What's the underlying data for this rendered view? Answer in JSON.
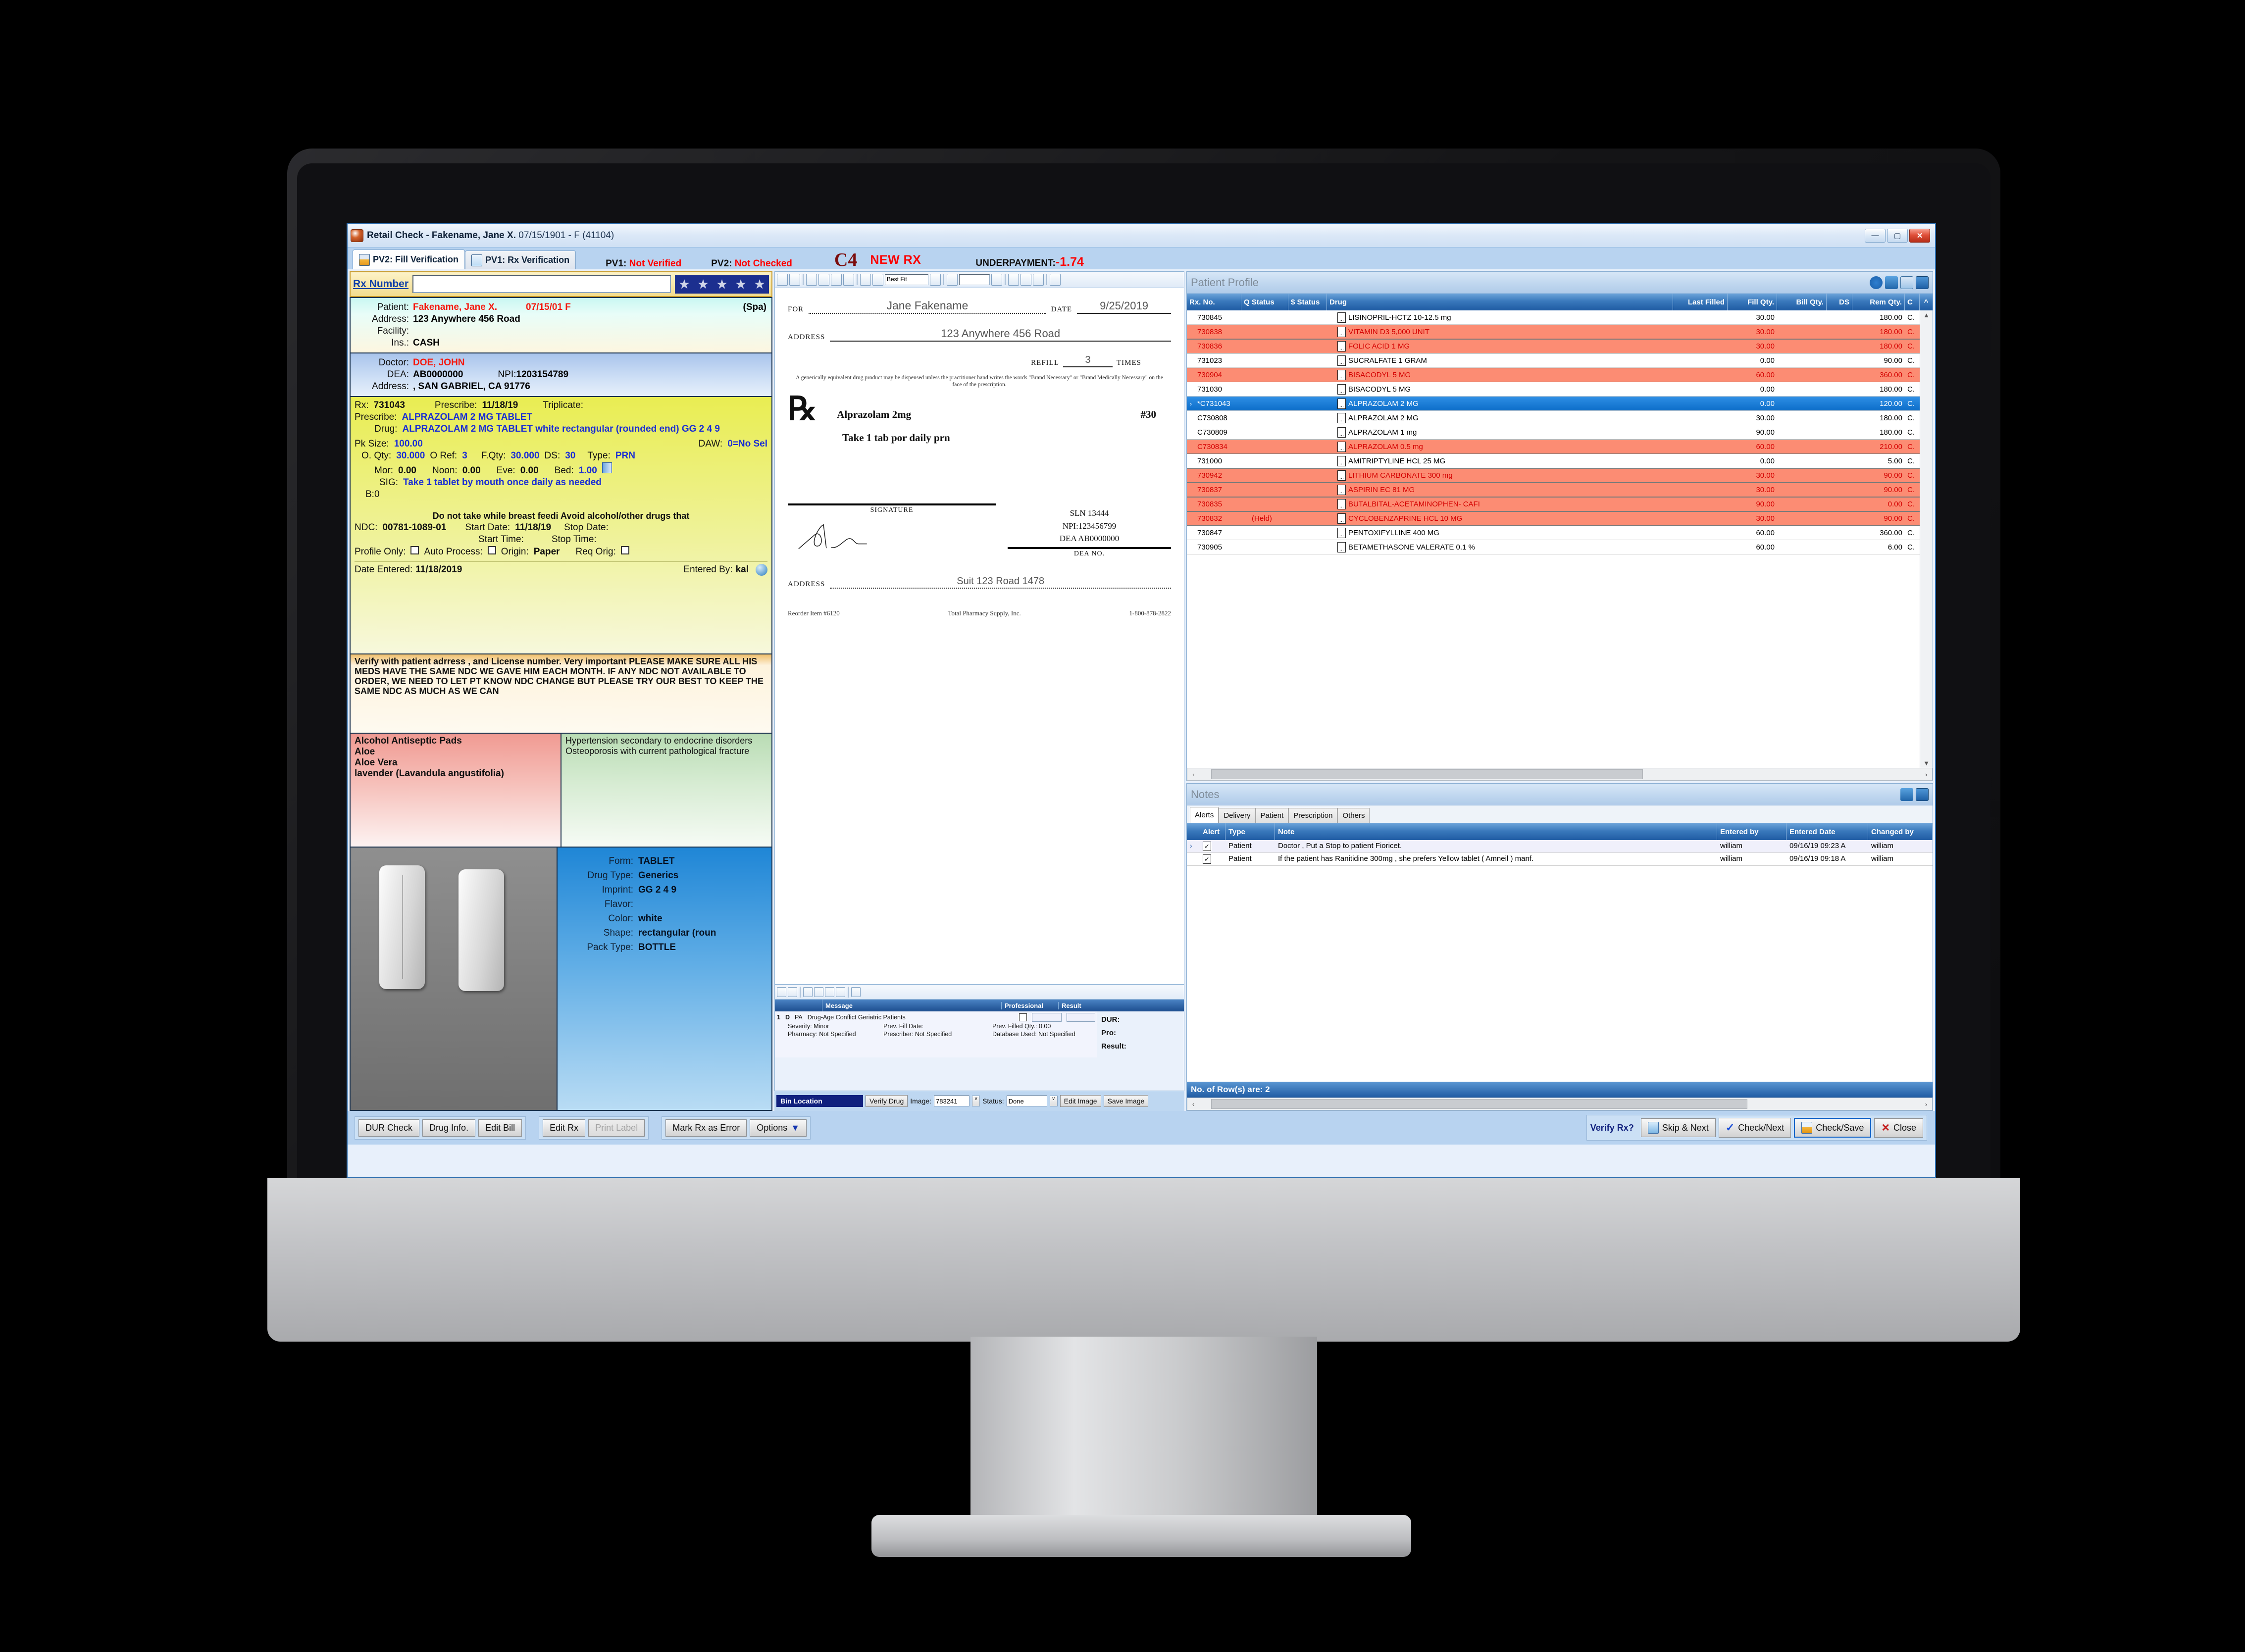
{
  "window": {
    "title_main": "Retail Check - Fakename, Jane X.",
    "title_sub": "07/15/1901 - F (41104)",
    "minimize": "—",
    "maximize": "▢",
    "close": "✕"
  },
  "tabs": [
    {
      "label": "PV2: Fill Verification",
      "icon": "vial-icon",
      "active": true
    },
    {
      "label": "PV1: Rx Verification",
      "icon": "document-check-icon",
      "active": false
    }
  ],
  "status": {
    "pv1_label": "PV1:",
    "pv1_value": "Not Verified",
    "pv2_label": "PV2:",
    "pv2_value": "Not Checked",
    "class_code": "C4",
    "new_rx": "NEW RX",
    "underpayment_label": "UNDERPAYMENT:",
    "underpayment_value": "-1.74"
  },
  "rx_number": {
    "label": "Rx Number",
    "value": "",
    "placeholder": ""
  },
  "patient": {
    "patient_label": "Patient:",
    "patient_name": "Fakename, Jane X.",
    "dob_sex": "07/15/01 F",
    "spa": "(Spa)",
    "address_label": "Address:",
    "address": "123 Anywhere 456 Road",
    "facility_label": "Facility:",
    "facility": "",
    "ins_label": "Ins.:",
    "ins": "CASH"
  },
  "doctor": {
    "doctor_label": "Doctor:",
    "doctor_name": "DOE, JOHN",
    "dea_label": "DEA:",
    "dea": "AB0000000",
    "npi_label": "NPI:",
    "npi": "1203154789",
    "address_label": "Address:",
    "address": ", SAN GABRIEL,  CA 91776"
  },
  "rx": {
    "rx_label": "Rx:",
    "rx_no": "731043",
    "prescribe_date_label": "Prescribe:",
    "prescribe_date": "11/18/19",
    "triplicate_label": "Triplicate:",
    "triplicate": "",
    "prescribe_label": "Prescribe:",
    "prescribe_drug": "ALPRAZOLAM   2    MG   TABLET",
    "drug_label": "Drug:",
    "drug": "ALPRAZOLAM  2 MG  TABLET   white   rectangular (rounded end)  GG  2  4  9",
    "pk_size_label": "Pk Size:",
    "pk_size": "100.00",
    "daw_label": "DAW:",
    "daw": "0=No Sel",
    "oqty_label": "O. Qty:",
    "oqty": "30.000",
    "oref_label": "O Ref:",
    "oref": "3",
    "fqty_label": "F.Qty:",
    "fqty": "30.000",
    "ds_label": "DS:",
    "ds": "30",
    "type_label": "Type:",
    "type": "PRN",
    "mor_label": "Mor:",
    "mor": "0.00",
    "noon_label": "Noon:",
    "noon": "0.00",
    "eve_label": "Eve:",
    "eve": "0.00",
    "bed_label": "Bed:",
    "bed": "1.00",
    "sig_label": "SIG:",
    "sig": "Take 1 tablet by mouth once daily  as needed",
    "b_line": "B:0",
    "warning": "Do not take while breast feedi  Avoid alcohol/other drugs that",
    "ndc_label": "NDC:",
    "ndc": "00781-1089-01",
    "start_date_label": "Start Date:",
    "start_date": "11/18/19",
    "stop_date_label": "Stop Date:",
    "stop_date": "",
    "start_time_label": "Start Time:",
    "start_time": "",
    "stop_time_label": "Stop Time:",
    "stop_time": "",
    "profile_only_label": "Profile Only:",
    "auto_process_label": "Auto Process:",
    "origin_label": "Origin:",
    "origin": "Paper",
    "req_orig_label": "Req Orig:",
    "date_entered_label": "Date Entered:",
    "date_entered": "11/18/2019",
    "entered_by_label": "Entered By:",
    "entered_by": "kal"
  },
  "verify_notes": "Verify with patient adrress , and License number. Very important PLEASE MAKE SURE ALL HIS MEDS HAVE THE SAME NDC WE GAVE HIM EACH MONTH.  IF ANY NDC NOT AVAILABLE TO ORDER,  WE NEED TO LET PT KNOW NDC CHANGE BUT PLEASE TRY OUR BEST TO KEEP THE SAME NDC AS MUCH AS WE CAN",
  "allergies": [
    "Alcohol Antiseptic Pads",
    "Aloe",
    "Aloe Vera",
    "lavender (Lavandula angustifolia)"
  ],
  "diagnoses": [
    "Hypertension secondary to endocrine disorders",
    "Osteoporosis with current pathological fracture"
  ],
  "drug_form": {
    "form_label": "Form:",
    "form": "TABLET",
    "drug_type_label": "Drug Type:",
    "drug_type": "Generics",
    "imprint_label": "Imprint:",
    "imprint": "GG  2  4  9",
    "flavor_label": "Flavor:",
    "flavor": "",
    "color_label": "Color:",
    "color": "white",
    "shape_label": "Shape:",
    "shape": "rectangular (roun",
    "pack_type_label": "Pack Type:",
    "pack_type": "BOTTLE"
  },
  "scrip": {
    "for_label": "FOR",
    "for_value": "Jane Fakename",
    "date_label": "DATE",
    "date_value": "9/25/2019",
    "address_label": "ADDRESS",
    "address_value": "123 Anywhere 456 Road",
    "refill_label": "REFILL",
    "refill_value": "3",
    "times_label": "TIMES",
    "legal": "A generically equivalent drug product may be dispensed unless the practitioner hand writes the words \"Brand Necessary\" or \"Brand Medically Necessary\" on the face of the prescription.",
    "rx_symbol": "℞",
    "drug": "Alprazolam 2mg",
    "qty": "#30",
    "sig": "Take 1 tab por daily prn",
    "sln": "SLN 13444",
    "npi": "NPI:123456799",
    "dea": "DEA AB0000000",
    "signature_label": "SIGNATURE",
    "dea_no_label": "DEA NO.",
    "addr2_label": "ADDRESS",
    "addr2_value": "Suit 123 Road 1478",
    "reorder": "Reorder Item #6120",
    "supplier": "Total Pharmacy Supply, Inc.",
    "phone": "1-800-878-2822"
  },
  "img_toolbar": {
    "zoom_value": "Best Fit",
    "page_value": ""
  },
  "dur": {
    "columns": [
      "Message",
      "Professional",
      "Result"
    ],
    "row_num": "1",
    "row_d": "D",
    "row_pa": "PA",
    "row_msg": "Drug-Age Conflict  Geriatric Patients",
    "severity": "Severity: Minor",
    "prev_fill_date": "Prev. Fill Date:",
    "prev_filled_qty": "Prev. Filled Qty.: 0.00",
    "pharmacy": "Pharmacy:  Not Specified",
    "prescriber": "Prescriber:  Not Specified",
    "database_used": "Database Used: Not Specified",
    "side_dur": "DUR:",
    "side_pro": "Pro:",
    "side_result": "Result:"
  },
  "binbar": {
    "bin_location": "Bin Location",
    "verify_drug": "Verify Drug",
    "image_label": "Image:",
    "image_value": "783241",
    "status_label": "Status:",
    "status_value": "Done",
    "edit_image": "Edit Image",
    "save_image": "Save Image"
  },
  "patient_profile": {
    "title": "Patient Profile",
    "icons": [
      "refresh-icon",
      "grid-icon",
      "history-icon",
      "panel-icon"
    ],
    "columns": [
      "Rx. No.",
      "Q Status",
      "$ Status",
      "Drug",
      "Last Filled",
      "Fill Qty.",
      "Bill Qty.",
      "DS",
      "Rem Qty.",
      "C"
    ],
    "rows": [
      {
        "rx": "730845",
        "q": "",
        "s": "",
        "drug": "LISINOPRIL-HCTZ 10-12.5 mg",
        "lf": "",
        "fq": "30.00",
        "bq": "",
        "ds": "",
        "rq": "180.00",
        "c": "C.",
        "style": "normal"
      },
      {
        "rx": "730838",
        "q": "",
        "s": "",
        "drug": "VITAMIN D3 5,000 UNIT",
        "lf": "",
        "fq": "30.00",
        "bq": "",
        "ds": "",
        "rq": "180.00",
        "c": "C.",
        "style": "alert"
      },
      {
        "rx": "730836",
        "q": "",
        "s": "",
        "drug": "FOLIC ACID 1 MG",
        "lf": "",
        "fq": "30.00",
        "bq": "",
        "ds": "",
        "rq": "180.00",
        "c": "C.",
        "style": "alert"
      },
      {
        "rx": "731023",
        "q": "",
        "s": "",
        "drug": "SUCRALFATE 1 GRAM",
        "lf": "",
        "fq": "0.00",
        "bq": "",
        "ds": "",
        "rq": "90.00",
        "c": "C.",
        "style": "normal"
      },
      {
        "rx": "730904",
        "q": "",
        "s": "",
        "drug": "BISACODYL 5 MG",
        "lf": "",
        "fq": "60.00",
        "bq": "",
        "ds": "",
        "rq": "360.00",
        "c": "C.",
        "style": "alert"
      },
      {
        "rx": "731030",
        "q": "",
        "s": "",
        "drug": "BISACODYL 5 MG",
        "lf": "",
        "fq": "0.00",
        "bq": "",
        "ds": "",
        "rq": "180.00",
        "c": "C.",
        "style": "normal"
      },
      {
        "rx": "*C731043",
        "q": "",
        "s": "",
        "drug": "ALPRAZOLAM 2 MG",
        "lf": "",
        "fq": "0.00",
        "bq": "",
        "ds": "",
        "rq": "120.00",
        "c": "C.",
        "style": "selected"
      },
      {
        "rx": "C730808",
        "q": "",
        "s": "",
        "drug": "ALPRAZOLAM 2 MG",
        "lf": "",
        "fq": "30.00",
        "bq": "",
        "ds": "",
        "rq": "180.00",
        "c": "C.",
        "style": "normal"
      },
      {
        "rx": "C730809",
        "q": "",
        "s": "",
        "drug": "ALPRAZOLAM 1 mg",
        "lf": "",
        "fq": "90.00",
        "bq": "",
        "ds": "",
        "rq": "180.00",
        "c": "C.",
        "style": "normal"
      },
      {
        "rx": "C730834",
        "q": "",
        "s": "",
        "drug": "ALPRAZOLAM 0.5 mg",
        "lf": "",
        "fq": "60.00",
        "bq": "",
        "ds": "",
        "rq": "210.00",
        "c": "C.",
        "style": "alert"
      },
      {
        "rx": "731000",
        "q": "",
        "s": "",
        "drug": "AMITRIPTYLINE HCL 25 MG",
        "lf": "",
        "fq": "0.00",
        "bq": "",
        "ds": "",
        "rq": "5.00",
        "c": "C.",
        "style": "normal"
      },
      {
        "rx": "730942",
        "q": "",
        "s": "",
        "drug": "LITHIUM CARBONATE 300 mg",
        "lf": "",
        "fq": "30.00",
        "bq": "",
        "ds": "",
        "rq": "90.00",
        "c": "C.",
        "style": "alert"
      },
      {
        "rx": "730837",
        "q": "",
        "s": "",
        "drug": "ASPIRIN EC 81 MG",
        "lf": "",
        "fq": "30.00",
        "bq": "",
        "ds": "",
        "rq": "90.00",
        "c": "C.",
        "style": "alert"
      },
      {
        "rx": "730835",
        "q": "",
        "s": "",
        "drug": "BUTALBITAL-ACETAMINOPHEN- CAFI",
        "lf": "",
        "fq": "90.00",
        "bq": "",
        "ds": "",
        "rq": "0.00",
        "c": "C.",
        "style": "alert"
      },
      {
        "rx": "730832",
        "q": "(Held)",
        "s": "",
        "drug": "CYCLOBENZAPRINE HCL 10 MG",
        "lf": "",
        "fq": "30.00",
        "bq": "",
        "ds": "",
        "rq": "90.00",
        "c": "C.",
        "style": "alert"
      },
      {
        "rx": "730847",
        "q": "",
        "s": "",
        "drug": "PENTOXIFYLLINE 400 MG",
        "lf": "",
        "fq": "60.00",
        "bq": "",
        "ds": "",
        "rq": "360.00",
        "c": "C.",
        "style": "normal"
      },
      {
        "rx": "730905",
        "q": "",
        "s": "",
        "drug": "BETAMETHASONE VALERATE 0.1 %",
        "lf": "",
        "fq": "60.00",
        "bq": "",
        "ds": "",
        "rq": "6.00",
        "c": "C.",
        "style": "normal"
      }
    ]
  },
  "notes": {
    "title": "Notes",
    "icons": [
      "grid-icon",
      "panel-icon"
    ],
    "tabs": [
      "Alerts",
      "Delivery",
      "Patient",
      "Prescription",
      "Others"
    ],
    "active_tab": "Alerts",
    "columns": [
      "Alert",
      "Type",
      "Note",
      "Entered by",
      "Entered Date",
      "Changed by"
    ],
    "rows": [
      {
        "alert": "✓",
        "type": "Patient",
        "note": "Doctor , Put a Stop to patient Fioricet.",
        "entered_by": "william",
        "entered_date": "09/16/19 09:23 A",
        "changed_by": "william"
      },
      {
        "alert": "✓",
        "type": "Patient",
        "note": "If the patient has Ranitidine 300mg , she prefers Yellow tablet ( Amneil ) manf.",
        "entered_by": "william",
        "entered_date": "09/16/19 09:18 A",
        "changed_by": "william"
      }
    ],
    "row_count": "No. of Row(s) are: 2"
  },
  "bottom_bar": {
    "group1": [
      "DUR Check",
      "Drug Info.",
      "Edit Bill"
    ],
    "group2": [
      "Edit Rx",
      "Print Label"
    ],
    "group3": [
      "Mark Rx as Error",
      "Options"
    ],
    "verify_label": "Verify Rx?",
    "group4": [
      "Skip & Next",
      "Check/Next",
      "Check/Save",
      "Close"
    ]
  },
  "colors": {
    "accent_blue": "#1f5ba3",
    "alert_red": "#fc8c73",
    "select_blue": "#0d6ec9",
    "rx_yellow": "#e9ed52",
    "status_red": "#fb0000"
  }
}
